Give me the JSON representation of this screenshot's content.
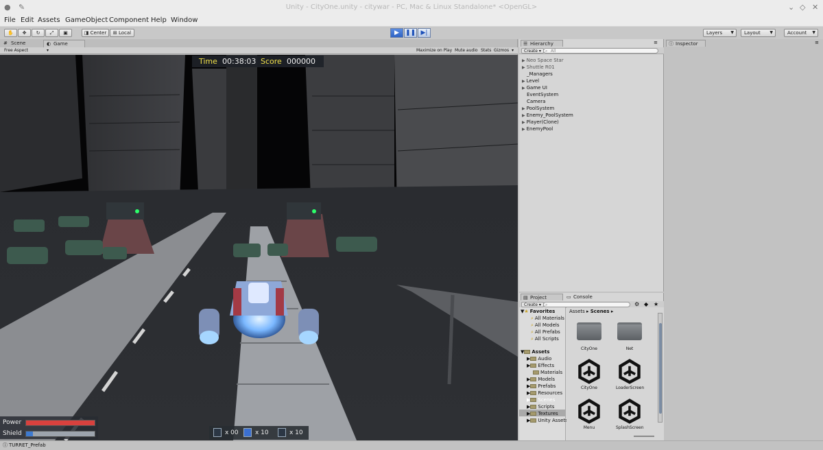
{
  "window": {
    "title": "Unity - CityOne.unity - citywar - PC, Mac & Linux Standalone* <OpenGL>"
  },
  "menu": [
    "File",
    "Edit",
    "Assets",
    "GameObject",
    "Component",
    "Help",
    "Window"
  ],
  "toolbar": {
    "pivot_label": "Center",
    "space_label": "Local",
    "layers_label": "Layers",
    "layout_label": "Layout",
    "account_label": "Account"
  },
  "game_panel": {
    "tab_scene": "Scene",
    "tab_game": "Game",
    "aspect": "Free Aspect",
    "maximize_on_play": "Maximize on Play",
    "mute_audio": "Mute audio",
    "stats": "Stats",
    "gizmos": "Gizmos"
  },
  "hud": {
    "time_label": "Time",
    "time_value": "00:38:03",
    "score_label": "Score",
    "score_value": "000000",
    "power_label": "Power",
    "power_level": 1.0,
    "shield_label": "Shield",
    "shield_level": 0.1,
    "ammo": [
      "x 00",
      "x 10",
      "x 10"
    ]
  },
  "hierarchy": {
    "tab": "Hierarchy",
    "create_label": "Create",
    "search_placeholder": "All",
    "items": [
      "Neo Space Star",
      "Shuttle R01",
      "_Managers",
      "Level",
      "Game UI",
      "EventSystem",
      "Camera",
      "PoolSystem",
      "Enemy_PoolSystem",
      "Player(Clone)",
      "EnemyPool"
    ]
  },
  "inspector": {
    "tab": "Inspector"
  },
  "project": {
    "tab_project": "Project",
    "tab_console": "Console",
    "create_label": "Create",
    "favorites": [
      "Favorites",
      "All Materials",
      "All Models",
      "All Prefabs",
      "All Scripts"
    ],
    "assets_root": "Assets",
    "asset_folders": [
      "Audio",
      "Effects",
      "Materials",
      "Models",
      "Prefabs",
      "Resources",
      "Scenes",
      "Scripts",
      "Textures",
      "Unity Assets"
    ],
    "breadcrumb_root": "Assets",
    "breadcrumb_current": "Scenes",
    "contents": [
      "CityOne",
      "Net",
      "CityOne",
      "LoaderScreen",
      "Menu",
      "SplashScreen"
    ]
  },
  "status": {
    "text": "TURRET_Prefab"
  },
  "colors": {
    "power": "#d8413e",
    "shield": "#3d7ad1",
    "hud_label": "#f0e04a"
  }
}
